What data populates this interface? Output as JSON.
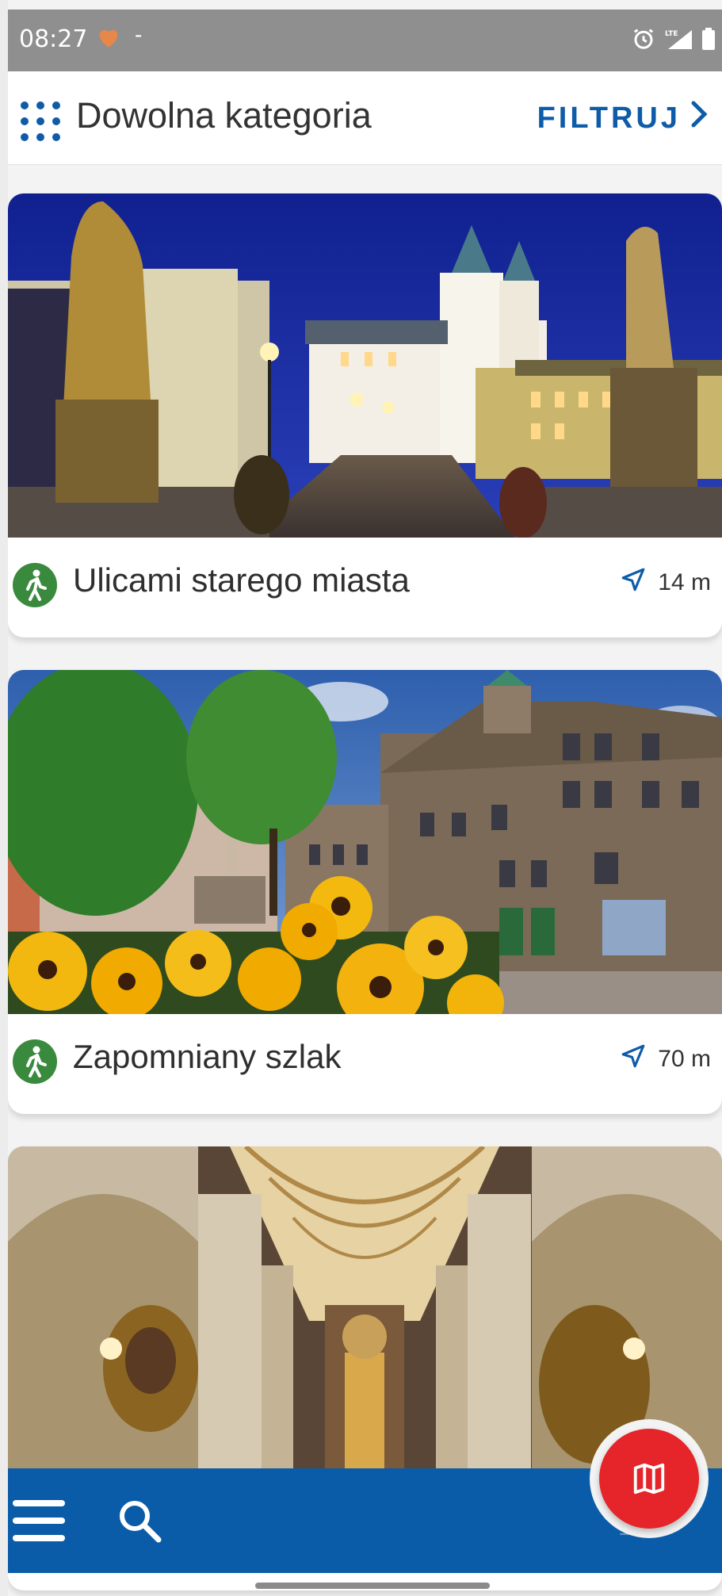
{
  "status_bar": {
    "time": "08:27",
    "dash": "-",
    "network": "LTE",
    "heart_color": "#e8874a"
  },
  "header": {
    "category_title": "Dowolna kategoria",
    "filter_label": "FILTRUJ",
    "accent_color": "#0e5ca8"
  },
  "routes": [
    {
      "name": "Ulicami starego miasta",
      "distance": "14 m",
      "icon": "walking-person-icon"
    },
    {
      "name": "Zapomniany szlak",
      "distance": "70 m",
      "icon": "walking-person-icon"
    },
    {
      "name": "",
      "distance": "",
      "icon": "walking-person-icon"
    }
  ],
  "bottom_bar": {
    "color": "#0b5ca8",
    "menu_icon": "hamburger-menu-icon",
    "search_icon": "search-icon",
    "map_fab_icon": "map-icon",
    "fab_color": "#e52529",
    "peek_distance": "11"
  }
}
